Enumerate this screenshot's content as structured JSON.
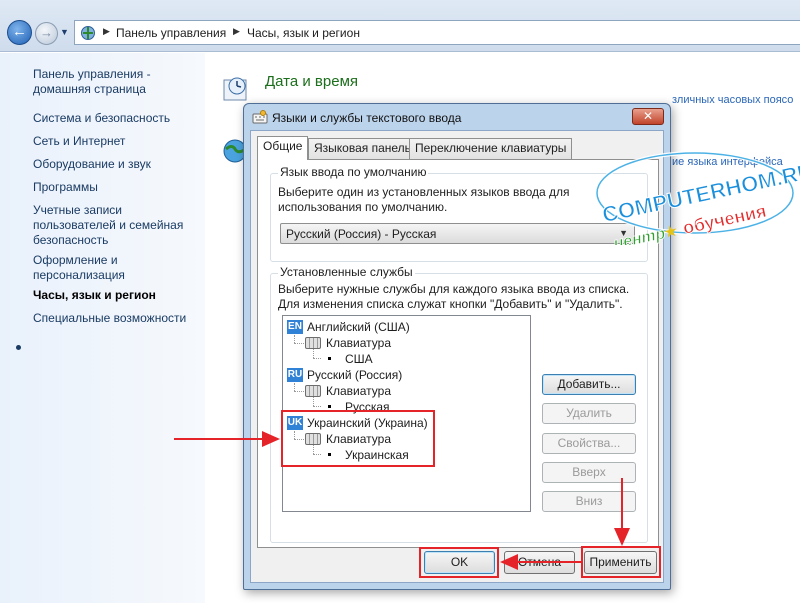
{
  "address_bar": {
    "segments": [
      "Панель управления",
      "Часы, язык и регион"
    ]
  },
  "left_nav": {
    "items": [
      {
        "label": "Панель управления - домашняя страница"
      },
      {
        "label": "Система и безопасность"
      },
      {
        "label": "Сеть и Интернет"
      },
      {
        "label": "Оборудование и звук"
      },
      {
        "label": "Программы"
      },
      {
        "label": "Учетные записи пользователей и семейная безопасность"
      },
      {
        "label": "Оформление и персонализация"
      },
      {
        "label": "Часы, язык и регион"
      },
      {
        "label": "Специальные возможности"
      }
    ],
    "active_index": 7
  },
  "background": {
    "section_title": "Дата и время",
    "fragment_1": "зличных часовых поясо",
    "fragment_2": "ие языка интерфейса"
  },
  "dialog": {
    "title": "Языки и службы текстового ввода",
    "close_label": "✕",
    "tabs": [
      "Общие",
      "Языковая панель",
      "Переключение клавиатуры"
    ],
    "active_tab": 0,
    "default_lang": {
      "legend": "Язык ввода по умолчанию",
      "description": "Выберите один из установленных языков ввода для использования по умолчанию.",
      "selected": "Русский (Россия) - Русская"
    },
    "services": {
      "legend": "Установленные службы",
      "description": "Выберите нужные службы для каждого языка ввода из списка. Для изменения списка служат кнопки \"Добавить\" и \"Удалить\".",
      "tree": [
        {
          "code": "EN",
          "language": "Английский (США)",
          "category": "Клавиатура",
          "layout": "США"
        },
        {
          "code": "RU",
          "language": "Русский (Россия)",
          "category": "Клавиатура",
          "layout": "Русская"
        },
        {
          "code": "UK",
          "language": "Украинский (Украина)",
          "category": "Клавиатура",
          "layout": "Украинская"
        }
      ],
      "buttons": {
        "add": "Добавить...",
        "remove": "Удалить",
        "properties": "Свойства...",
        "up": "Вверх",
        "down": "Вниз"
      }
    },
    "footer": {
      "ok": "OK",
      "cancel": "Отмена",
      "apply": "Применить"
    }
  },
  "watermark": {
    "line1": "COMPUTERHOM.RU",
    "line2a": "центр",
    "line2b": "обучения"
  },
  "colors": {
    "highlight": "#e5242a",
    "badge": "#2f82d6",
    "nav_text": "#1a3b63"
  }
}
